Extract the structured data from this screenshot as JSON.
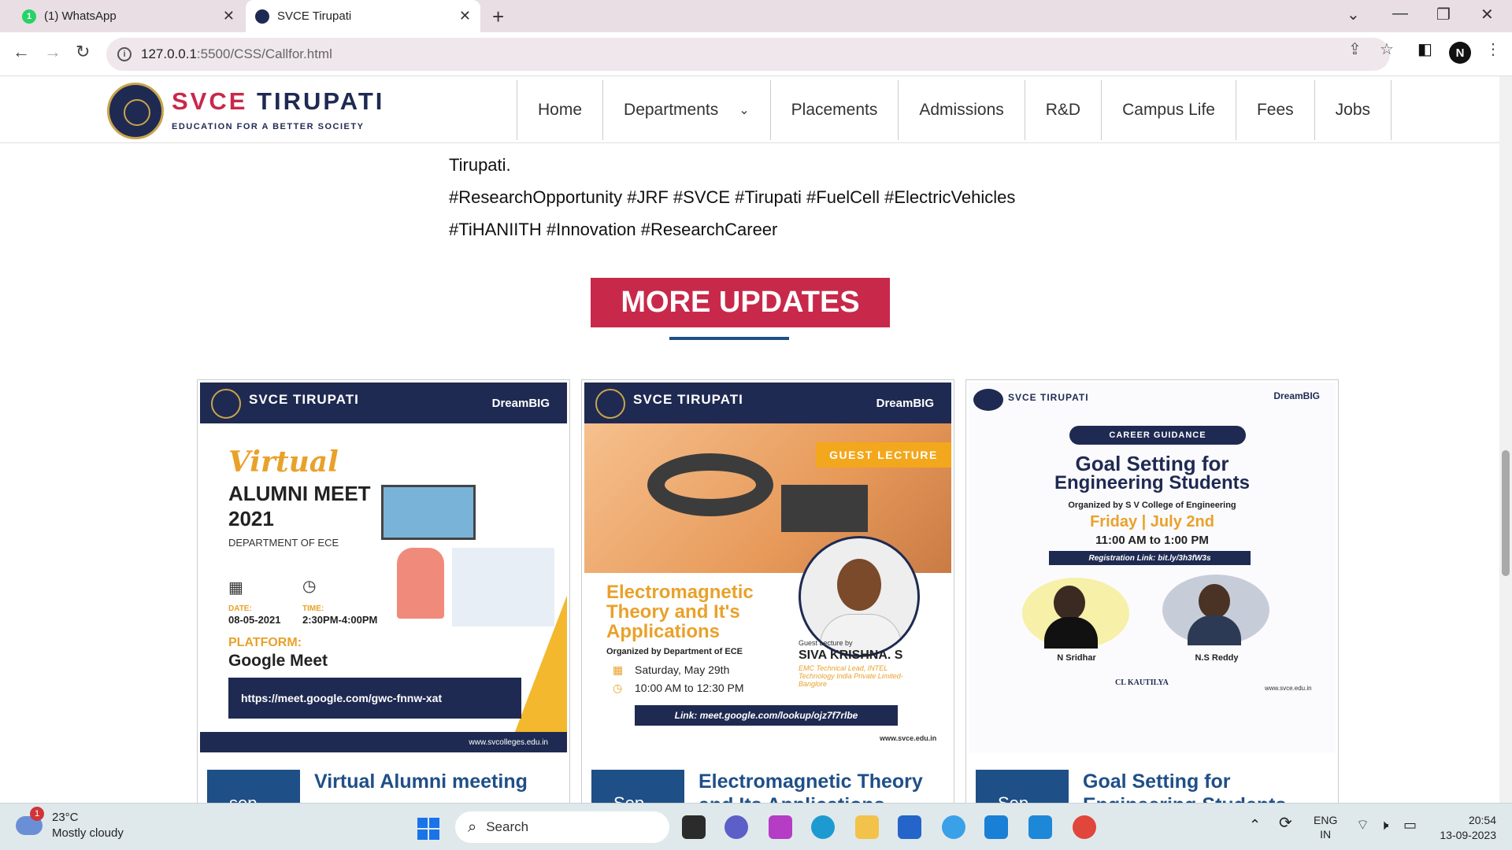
{
  "browser": {
    "tabs": [
      {
        "title": "(1) WhatsApp",
        "badge": "1"
      },
      {
        "title": "SVCE Tirupati"
      }
    ],
    "url_host": "127.0.0.1",
    "url_path": ":5500/CSS/Callfor.html",
    "profile_initial": "N"
  },
  "site": {
    "brand_left": "SVCE",
    "brand_right": "TIRUPATI",
    "tagline": "EDUCATION FOR A BETTER SOCIETY",
    "nav": [
      "Home",
      "Departments",
      "Placements",
      "Admissions",
      "R&D",
      "Campus Life",
      "Fees",
      "Jobs"
    ]
  },
  "content": {
    "line1": "Tirupati.",
    "line2": "#ResearchOpportunity #JRF #SVCE #Tirupati #FuelCell #ElectricVehicles",
    "line3": "#TiHANIITH #Innovation #ResearchCareer",
    "more_updates": "MORE UPDATES"
  },
  "cards": [
    {
      "title": "Virtual Alumni meeting",
      "date": "sep",
      "poster": {
        "script": "Virtual",
        "heading1": "ALUMNI MEET",
        "heading2": "2021",
        "dept": "DEPARTMENT OF ECE",
        "date_label": "DATE:",
        "date": "08-05-2021",
        "time_label": "TIME:",
        "time": "2:30PM-4:00PM",
        "platform_label": "PLATFORM:",
        "platform": "Google Meet",
        "link": "https://meet.google.com/gwc-fnnw-xat",
        "site": "www.svcolleges.edu.in",
        "brand": "SVCE TIRUPATI",
        "dream": "DreamBIG"
      }
    },
    {
      "title": "Electromagnetic Theory and Its Applications",
      "date": "Sep",
      "poster": {
        "tag": "GUEST LECTURE",
        "heading": "Electromagnetic Theory and It's Applications",
        "org": "Organized by Department of ECE",
        "day": "Saturday, May 29th",
        "time": "10:00 AM to 12:30 PM",
        "guest_label": "Guest Lecture by",
        "guest": "SIVA KRISHNA. S",
        "guest_role": "EMC Technical Lead, INTEL Technology India Private Limited-Banglore",
        "link": "Link: meet.google.com/lookup/ojz7f7rlbe",
        "site": "www.svce.edu.in",
        "brand": "SVCE TIRUPATI",
        "dream": "DreamBIG"
      }
    },
    {
      "title": "Goal Setting for Engineering Students",
      "date": "Sep",
      "poster": {
        "tag": "CAREER GUIDANCE",
        "heading1": "Goal Setting for",
        "heading2": "Engineering Students",
        "org": "Organized by S V College of Engineering",
        "day": "Friday | July 2nd",
        "time": "11:00 AM to 1:00 PM",
        "reg": "Registration Link: bit.ly/3h3fW3s",
        "speaker1": "N Sridhar",
        "speaker2": "N.S Reddy",
        "partner": "CL KAUTILYA",
        "site": "www.svce.edu.in",
        "brand": "SVCE TIRUPATI",
        "dream": "DreamBIG"
      }
    }
  ],
  "taskbar": {
    "temp": "23°C",
    "weather": "Mostly cloudy",
    "weather_badge": "1",
    "search": "Search",
    "lang1": "ENG",
    "lang2": "IN",
    "time": "20:54",
    "date": "13-09-2023"
  },
  "colors": {
    "brand_red": "#c8294a",
    "brand_navy": "#1f2a52",
    "link_blue": "#1f4f87"
  }
}
